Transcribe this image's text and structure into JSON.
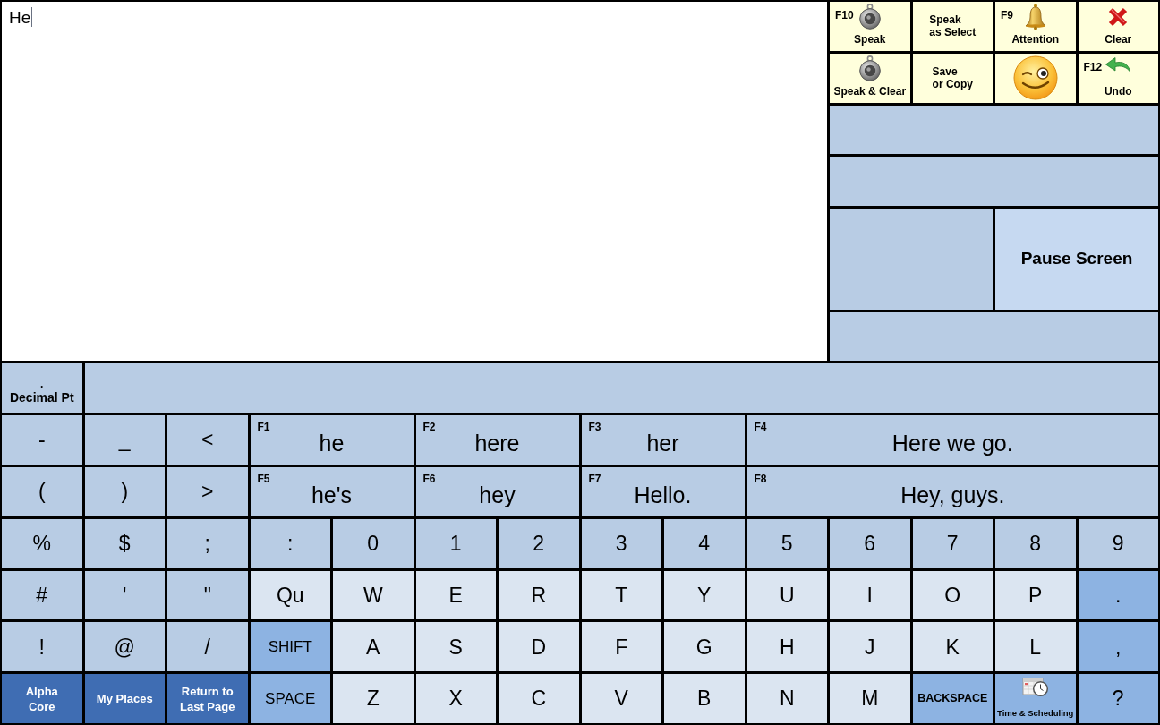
{
  "message": {
    "value": "He"
  },
  "quick_buttons": [
    {
      "kind": "speaker",
      "hotkey": "F10",
      "label": "Speak"
    },
    {
      "kind": "text",
      "label": "Speak\nas Select"
    },
    {
      "kind": "bell",
      "hotkey": "F9",
      "label": "Attention"
    },
    {
      "kind": "cross",
      "label": "Clear"
    },
    {
      "kind": "speaker",
      "label": "Speak & Clear"
    },
    {
      "kind": "text",
      "label": "Save\nor Copy"
    },
    {
      "kind": "smiley"
    },
    {
      "kind": "arrow",
      "hotkey": "F12",
      "label": "Undo"
    }
  ],
  "pause_button": {
    "label": "Pause Screen"
  },
  "decimal_key": {
    "symbol": ".",
    "label": "Decimal Pt"
  },
  "key_rows": [
    [
      {
        "kind": "symbol",
        "label": "-"
      },
      {
        "kind": "symbol",
        "label": "_"
      },
      {
        "kind": "symbol",
        "label": "<"
      },
      {
        "kind": "prediction",
        "hotkey": "F1",
        "label": "he"
      },
      {
        "kind": "prediction",
        "hotkey": "F2",
        "label": "here"
      },
      {
        "kind": "prediction",
        "hotkey": "F3",
        "label": "her"
      },
      {
        "kind": "prediction",
        "hotkey": "F4",
        "label": "Here we go."
      }
    ],
    [
      {
        "kind": "symbol",
        "label": "("
      },
      {
        "kind": "symbol",
        "label": ")"
      },
      {
        "kind": "symbol",
        "label": ">"
      },
      {
        "kind": "prediction",
        "hotkey": "F5",
        "label": "he's"
      },
      {
        "kind": "prediction",
        "hotkey": "F6",
        "label": "hey"
      },
      {
        "kind": "prediction",
        "hotkey": "F7",
        "label": "Hello."
      },
      {
        "kind": "prediction",
        "hotkey": "F8",
        "label": "Hey, guys."
      }
    ],
    [
      {
        "kind": "symbol",
        "label": "%"
      },
      {
        "kind": "symbol",
        "label": "$"
      },
      {
        "kind": "symbol",
        "label": ";"
      },
      {
        "kind": "symbol",
        "label": ":"
      },
      {
        "kind": "symbol",
        "label": "0"
      },
      {
        "kind": "symbol",
        "label": "1"
      },
      {
        "kind": "symbol",
        "label": "2"
      },
      {
        "kind": "symbol",
        "label": "3"
      },
      {
        "kind": "symbol",
        "label": "4"
      },
      {
        "kind": "symbol",
        "label": "5"
      },
      {
        "kind": "symbol",
        "label": "6"
      },
      {
        "kind": "symbol",
        "label": "7"
      },
      {
        "kind": "symbol",
        "label": "8"
      },
      {
        "kind": "symbol",
        "label": "9"
      }
    ],
    [
      {
        "kind": "symbol",
        "label": "#"
      },
      {
        "kind": "symbol",
        "label": "'"
      },
      {
        "kind": "symbol",
        "label": "\""
      },
      {
        "kind": "letter",
        "label": "Qu"
      },
      {
        "kind": "letter",
        "label": "W"
      },
      {
        "kind": "letter",
        "label": "E"
      },
      {
        "kind": "letter",
        "label": "R"
      },
      {
        "kind": "letter",
        "label": "T"
      },
      {
        "kind": "letter",
        "label": "Y"
      },
      {
        "kind": "letter",
        "label": "U"
      },
      {
        "kind": "letter",
        "label": "I"
      },
      {
        "kind": "letter",
        "label": "O"
      },
      {
        "kind": "letter",
        "label": "P"
      },
      {
        "kind": "action",
        "label": "."
      }
    ],
    [
      {
        "kind": "symbol",
        "label": "!"
      },
      {
        "kind": "symbol",
        "label": "@"
      },
      {
        "kind": "symbol",
        "label": "/"
      },
      {
        "kind": "action",
        "label": "SHIFT"
      },
      {
        "kind": "letter",
        "label": "A"
      },
      {
        "kind": "letter",
        "label": "S"
      },
      {
        "kind": "letter",
        "label": "D"
      },
      {
        "kind": "letter",
        "label": "F"
      },
      {
        "kind": "letter",
        "label": "G"
      },
      {
        "kind": "letter",
        "label": "H"
      },
      {
        "kind": "letter",
        "label": "J"
      },
      {
        "kind": "letter",
        "label": "K"
      },
      {
        "kind": "letter",
        "label": "L"
      },
      {
        "kind": "action",
        "label": ","
      }
    ],
    [
      {
        "kind": "nav",
        "label": "Alpha\nCore"
      },
      {
        "kind": "nav",
        "label": "My Places"
      },
      {
        "kind": "nav",
        "label": "Return to\nLast Page"
      },
      {
        "kind": "action",
        "label": "SPACE"
      },
      {
        "kind": "letter",
        "label": "Z"
      },
      {
        "kind": "letter",
        "label": "X"
      },
      {
        "kind": "letter",
        "label": "C"
      },
      {
        "kind": "letter",
        "label": "V"
      },
      {
        "kind": "letter",
        "label": "B"
      },
      {
        "kind": "letter",
        "label": "N"
      },
      {
        "kind": "letter",
        "label": "M"
      },
      {
        "kind": "action",
        "label": "BACKSPACE"
      },
      {
        "kind": "schedule",
        "label": "Time & Scheduling"
      },
      {
        "kind": "action",
        "label": "?"
      }
    ]
  ]
}
